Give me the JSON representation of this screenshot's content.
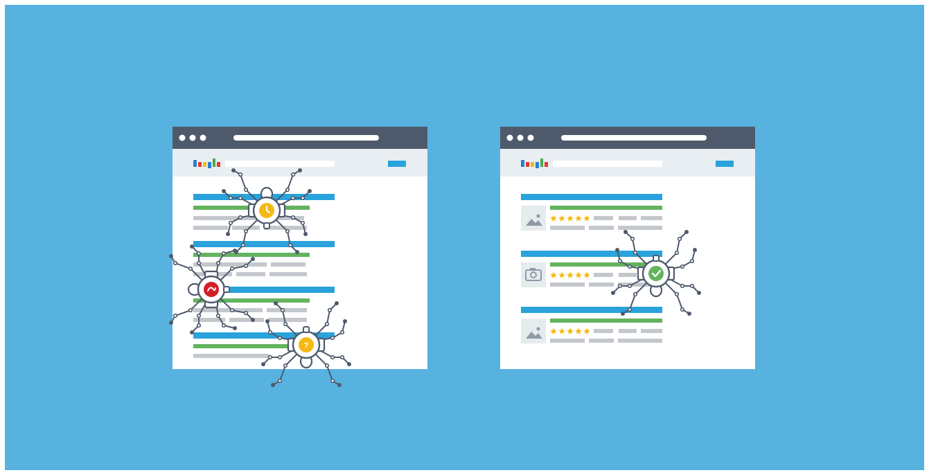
{
  "background": "#57b2e0",
  "colors": {
    "titlebar": "#4e5a6b",
    "dot": "#ffffff",
    "page": "#ffffff",
    "header_band": "#e9eef2",
    "result_title": "#2aa2dc",
    "result_url": "#64b35e",
    "result_snippet": "#c4c8cc",
    "search_button": "#2aa2dc",
    "star": "#f5b916",
    "thumb_bg": "#e6ebee",
    "thumb_icon": "#8f9aa6",
    "spider_body": "#ffffff",
    "spider_line": "#4e5a6b",
    "badge_clock": "#f5b916",
    "badge_error": "#d32027",
    "badge_question": "#f5b916",
    "badge_check": "#64b35e"
  },
  "logo_letter_colors": [
    "#2a7fd6",
    "#e33b2e",
    "#f5b916",
    "#2a7fd6",
    "#49a84c",
    "#e33b2e"
  ],
  "left_window": {
    "result_count": 4,
    "spiders": [
      {
        "badge": "clock-icon",
        "direction": "down"
      },
      {
        "badge": "error-icon",
        "direction": "right"
      },
      {
        "badge": "question-icon",
        "direction": "up"
      }
    ]
  },
  "right_window": {
    "result_count": 3,
    "star_rating": 5,
    "thumbnails": [
      "image-icon",
      "camera-icon",
      "image-icon"
    ],
    "spiders": [
      {
        "badge": "check-icon",
        "direction": "up"
      }
    ]
  },
  "badge_glyphs": {
    "clock-icon": "",
    "error-icon": "",
    "question-icon": "?",
    "check-icon": ""
  }
}
